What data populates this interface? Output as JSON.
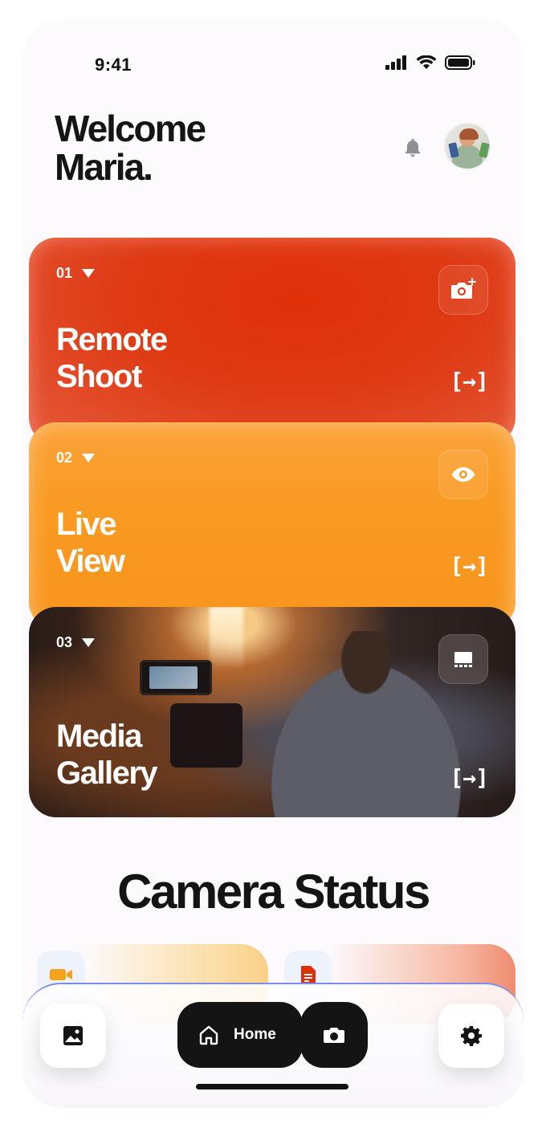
{
  "status_bar": {
    "time": "9:41"
  },
  "header": {
    "welcome_line1": "Welcome",
    "welcome_line2": "Maria."
  },
  "cards": [
    {
      "number": "01",
      "title_line1": "Remote",
      "title_line2": "Shoot",
      "icon": "camera-plus-icon",
      "arrow": "[→]",
      "color": "#e0300a"
    },
    {
      "number": "02",
      "title_line1": "Live",
      "title_line2": "View",
      "icon": "eye-icon",
      "arrow": "[→]",
      "color": "#f99a22"
    },
    {
      "number": "03",
      "title_line1": "Media",
      "title_line2": "Gallery",
      "icon": "gallery-icon",
      "arrow": "[→]",
      "color": "#2a1d18"
    }
  ],
  "section": {
    "title": "Camera Status"
  },
  "status_tiles": [
    {
      "icon": "video-camera-icon",
      "color": "#f7a21b"
    },
    {
      "icon": "document-icon",
      "color": "#e0300a"
    }
  ],
  "bottom_nav": {
    "home_label": "Home",
    "items": [
      "gallery-icon",
      "home-icon",
      "camera-icon",
      "settings-icon"
    ]
  },
  "colors": {
    "accent_dark": "#141414",
    "nav_border": "#7b8cf0",
    "background": "#fcfafc"
  }
}
